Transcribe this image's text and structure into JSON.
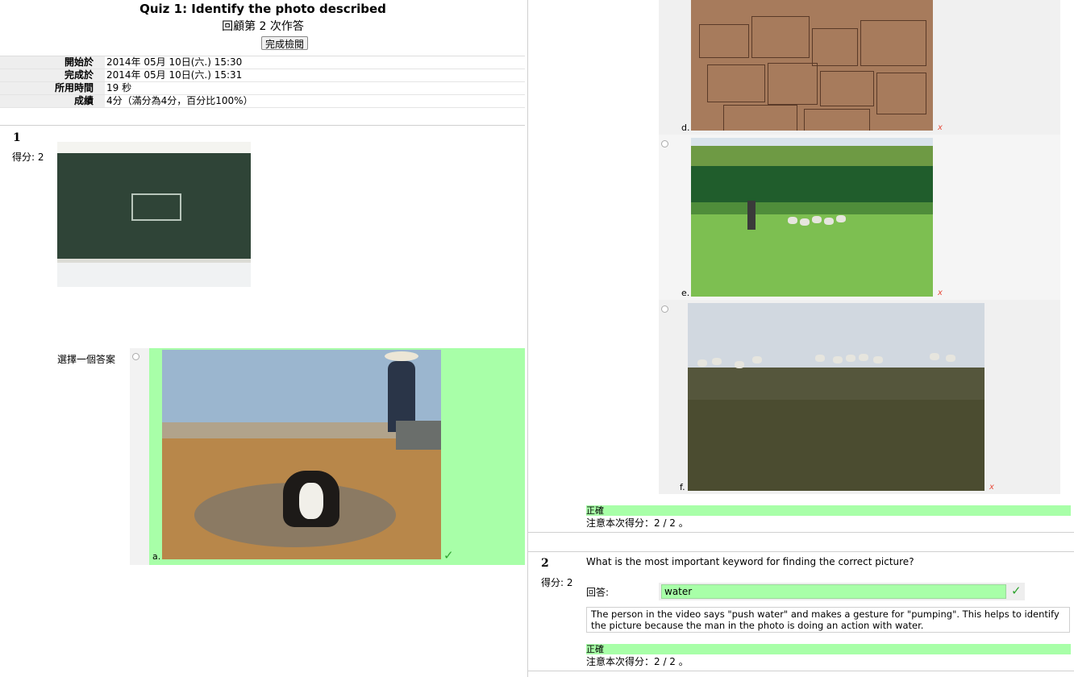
{
  "header": {
    "title": "Quiz 1: Identify the photo described",
    "subtitle": "回顧第 2 次作答",
    "finish_review_label": "完成檢閱"
  },
  "summary": [
    {
      "label": "開始於",
      "value": "2014年 05月 10日(六.) 15:30"
    },
    {
      "label": "完成於",
      "value": "2014年 05月 10日(六.) 15:31"
    },
    {
      "label": "所用時間",
      "value": "19 秒"
    },
    {
      "label": "成績",
      "value": "4分（滿分為4分，百分比100%）"
    }
  ],
  "question1": {
    "number": "1",
    "grade_label": "得分: 2",
    "prompt": "選擇一個答案",
    "answers": [
      {
        "letter": "a.",
        "mark": "✓",
        "correct": true
      },
      {
        "letter": "d.",
        "mark": "x",
        "correct": false
      },
      {
        "letter": "e.",
        "mark": "x",
        "correct": false
      },
      {
        "letter": "f.",
        "mark": "x",
        "correct": false
      }
    ],
    "feedback": "正確",
    "mark_text": "注意本次得分：2 / 2 。"
  },
  "question2": {
    "number": "2",
    "grade_label": "得分: 2",
    "text": "What is the most important keyword for finding the correct picture?",
    "answer_label": "回答:",
    "answer_value": "water",
    "answer_mark": "✓",
    "explanation": "The person in the video says \"push water\" and makes a gesture for \"pumping\". This helps to identify the picture because the man in the photo is doing an action with water.",
    "feedback": "正確",
    "mark_text": "注意本次得分：2 / 2 。"
  },
  "colors": {
    "correct_green": "#a8ffa8",
    "check_green": "#2ea32e",
    "wrong_red": "#e74c3c"
  },
  "icons": {
    "correct": "check-icon",
    "wrong": "cross-icon",
    "radio": "radio-icon"
  }
}
